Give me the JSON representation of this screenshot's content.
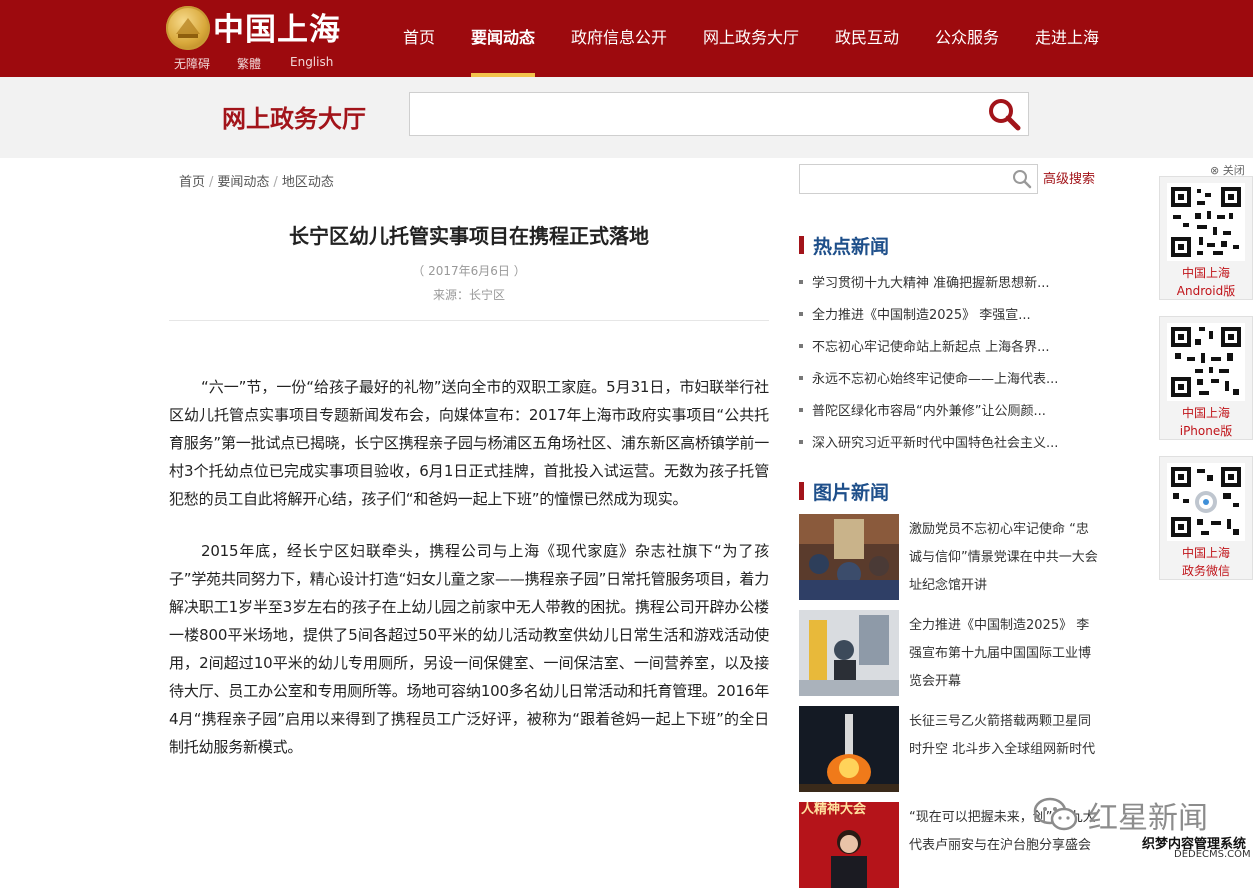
{
  "header": {
    "logo_text": "中国上海",
    "lang_links": [
      "无障碍",
      "繁體",
      "English"
    ],
    "nav": [
      "首页",
      "要闻动态",
      "政府信息公开",
      "网上政务大厅",
      "政民互动",
      "公众服务",
      "走进上海"
    ],
    "active_nav": "要闻动态",
    "colors": {
      "brand_red": "#9d0a0e",
      "accent_gold": "#f2c44c"
    }
  },
  "service_band": {
    "title": "网上政务大厅",
    "search_value": "",
    "search_icon": "search-icon"
  },
  "breadcrumb": [
    "首页",
    "要闻动态",
    "地区动态"
  ],
  "article": {
    "title": "长宁区幼儿托管实事项目在携程正式落地",
    "date": "（ 2017年6月6日 ）",
    "source": "来源：长宁区",
    "paragraphs": [
      "“六一”节，一份“给孩子最好的礼物”送向全市的双职工家庭。5月31日，市妇联举行社区幼儿托管点实事项目专题新闻发布会，向媒体宣布：2017年上海市政府实事项目“公共托育服务”第一批试点已揭晓，长宁区携程亲子园与杨浦区五角场社区、浦东新区高桥镇学前一村3个托幼点位已完成实事项目验收，6月1日正式挂牌，首批投入试运营。无数为孩子托管犯愁的员工自此将解开心结，孩子们“和爸妈一起上下班”的憧憬已然成为现实。",
      "2015年底，经长宁区妇联牵头，携程公司与上海《现代家庭》杂志社旗下“为了孩子”学苑共同努力下，精心设计打造“妇女儿童之家——携程亲子园”日常托管服务项目，着力解决职工1岁半至3岁左右的孩子在上幼儿园之前家中无人带教的困扰。携程公司开辟办公楼一楼800平米场地，提供了5间各超过50平米的幼儿活动教室供幼儿日常生活和游戏活动使用，2间超过10平米的幼儿专用厕所，另设一间保健室、一间保洁室、一间营养室，以及接待大厅、员工办公室和专用厕所等。场地可容纳100多名幼儿日常活动和托育管理。2016年4月“携程亲子园”启用以来得到了携程员工广泛好评，被称为“跟着爸妈一起上下班”的全日制托幼服务新模式。"
    ]
  },
  "sidebar": {
    "search_value": "",
    "advanced_search": "高级搜索",
    "hot_news_title": "热点新闻",
    "hot_news": [
      "学习贯彻十九大精神 准确把握新思想新...",
      "全力推进《中国制造2025》 李强宣...",
      "不忘初心牢记使命站上新起点 上海各界...",
      "永远不忘初心始终牢记使命——上海代表...",
      "普陀区绿化市容局“内外兼修”让公厕颜...",
      "深入研究习近平新时代中国特色社会主义..."
    ],
    "photo_news_title": "图片新闻",
    "photo_news": [
      "激励党员不忘初心牢记使命 “忠诚与信仰”情景党课在中共一大会址纪念馆开讲",
      "全力推进《中国制造2025》 李强宣布第十九届中国国际工业博览会开幕",
      "长征三号乙火箭搭载两颗卫星同时升空 北斗步入全球组网新时代",
      "“现在可以把握未来，创” 十九大代表卢丽安与在沪台胞分享盛会"
    ],
    "photo_banner_text": "人精神大会"
  },
  "qr_rail": {
    "close_label": "关闭",
    "cards": [
      {
        "line1": "中国上海",
        "line2": "Android版"
      },
      {
        "line1": "中国上海",
        "line2": "iPhone版"
      },
      {
        "line1": "中国上海",
        "line2": "政务微信"
      }
    ]
  },
  "watermark": {
    "text": "红星新闻",
    "footer": "织梦内容管理系统",
    "footer_small": "DEDECMS.COM"
  }
}
